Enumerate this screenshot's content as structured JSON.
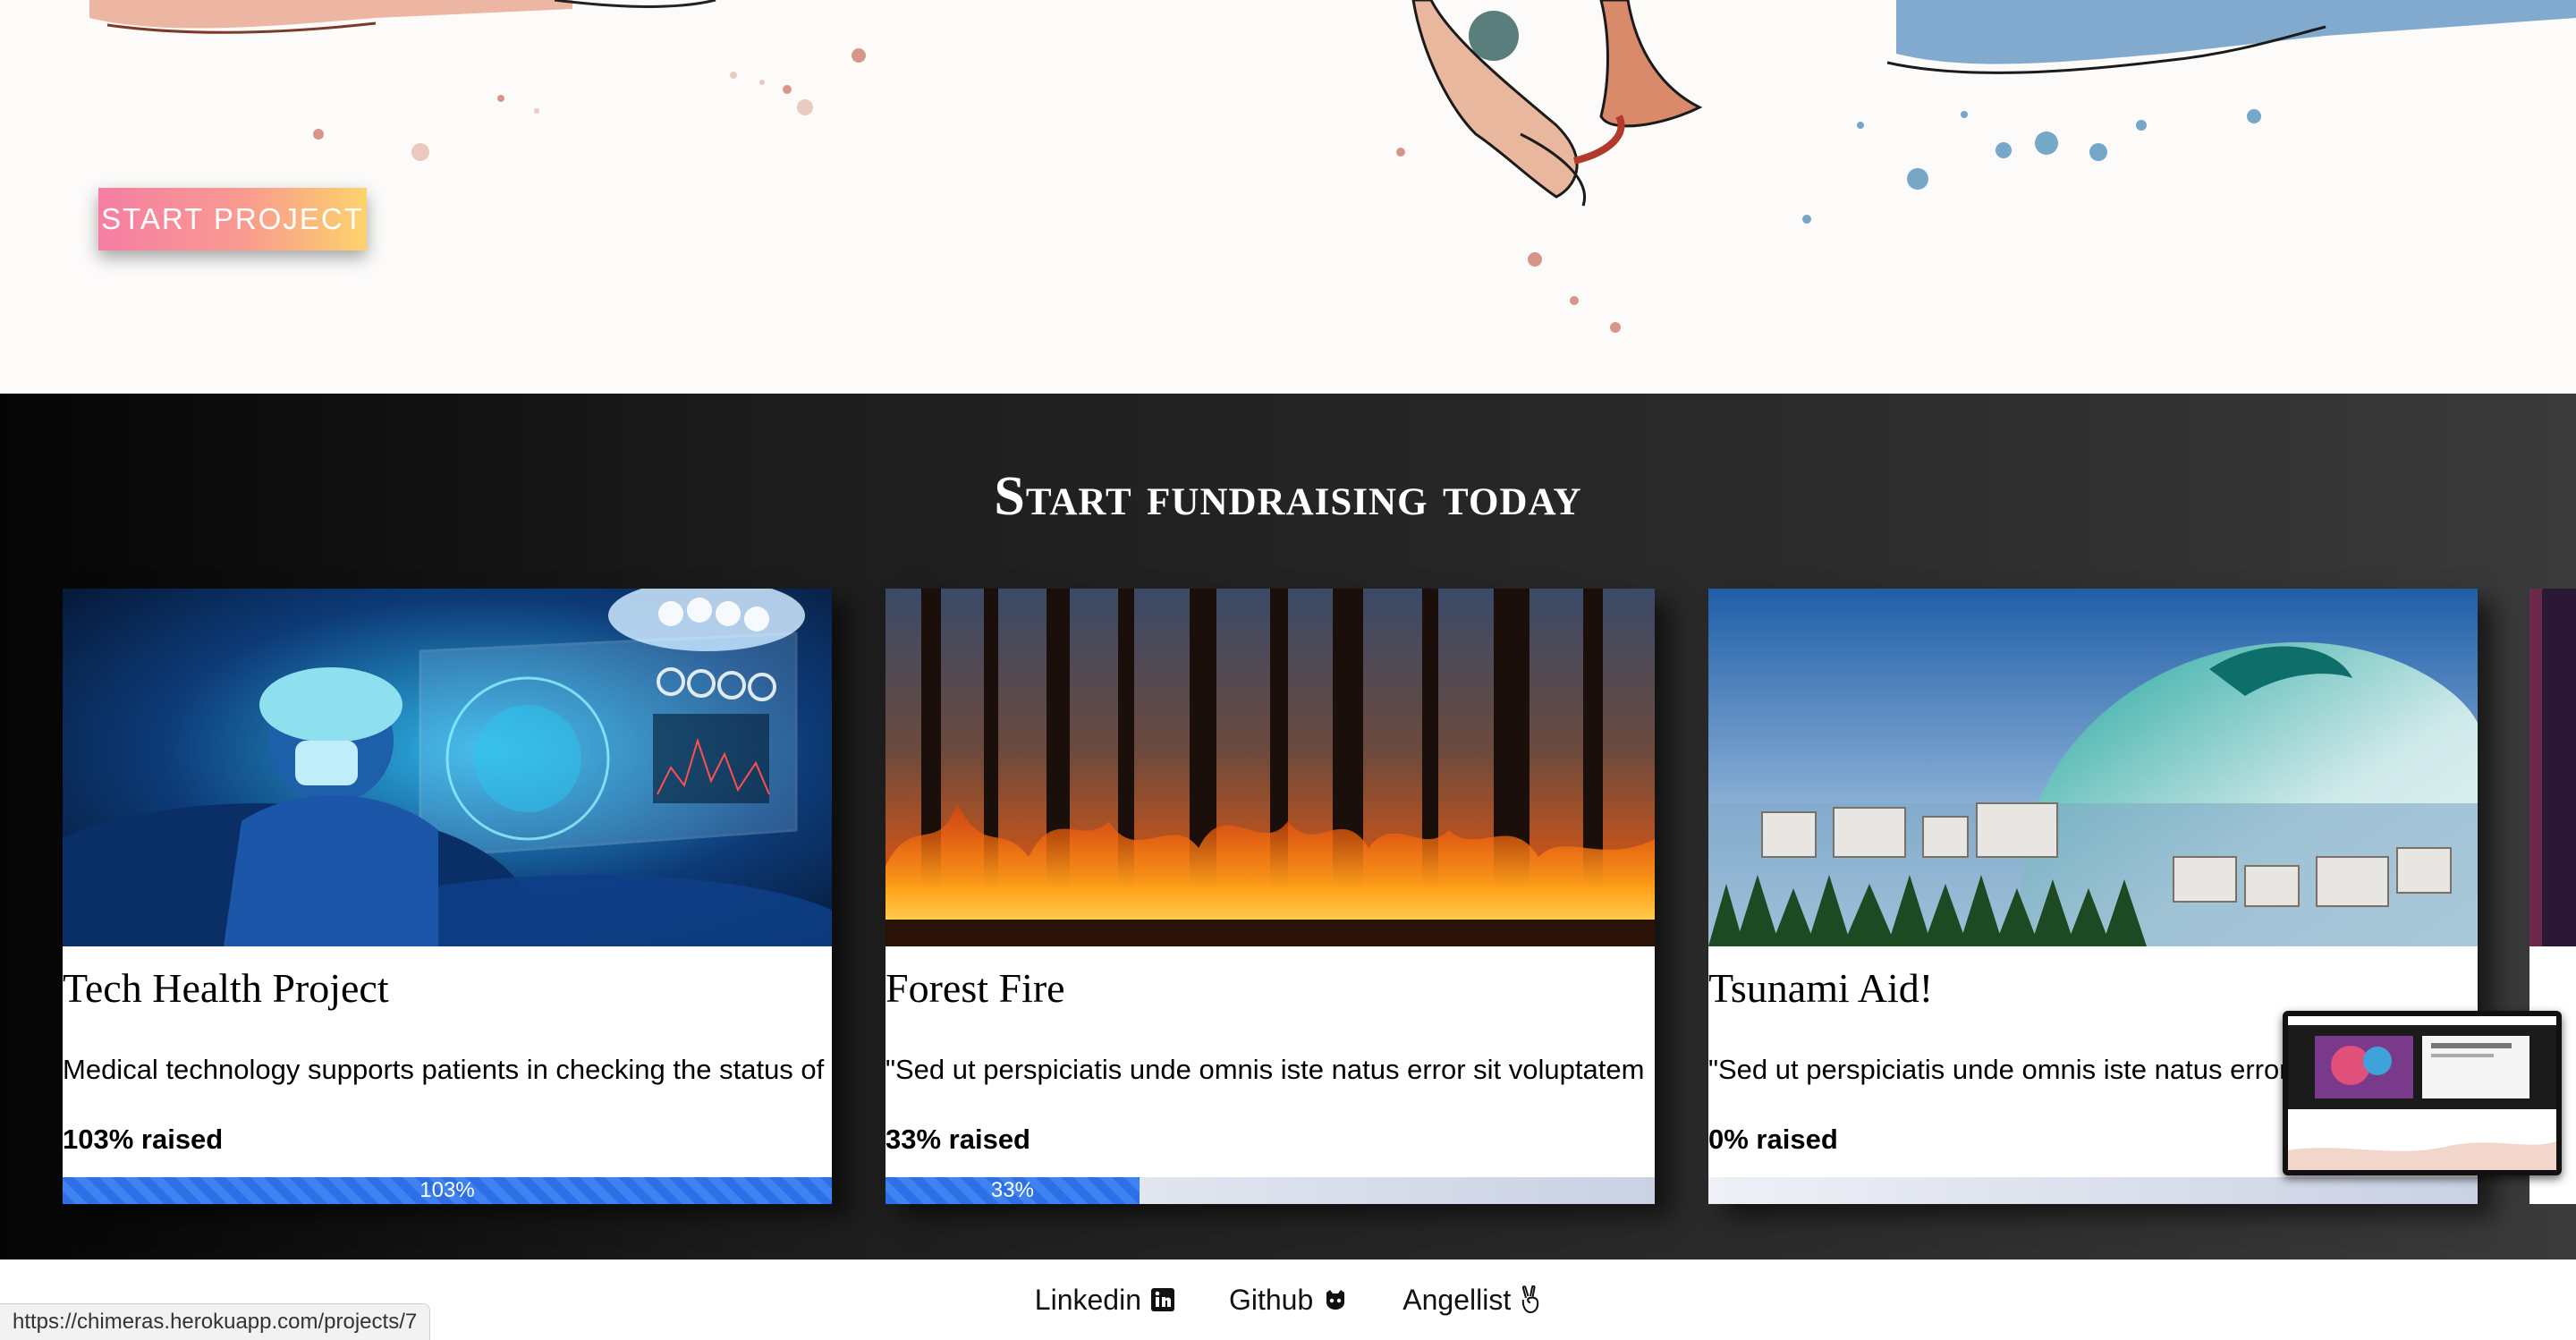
{
  "hero": {
    "start_button_label": "START PROJECT"
  },
  "fundraising": {
    "title": "Start fundraising today",
    "projects": [
      {
        "title": "Tech Health Project",
        "description": "Medical technology supports patients in checking the status of",
        "raised_label": "103% raised",
        "progress_percent": 103,
        "progress_label": "103%"
      },
      {
        "title": "Forest Fire",
        "description": "\"Sed ut perspiciatis unde omnis iste natus error sit voluptatem",
        "raised_label": "33% raised",
        "progress_percent": 33,
        "progress_label": "33%"
      },
      {
        "title": "Tsunami Aid!",
        "description": "\"Sed ut perspiciatis unde omnis iste natus error sit voluptatem",
        "raised_label": "0% raised",
        "progress_percent": 0,
        "progress_label": ""
      }
    ]
  },
  "footer": {
    "links": [
      {
        "label": "Linkedin",
        "icon": "linkedin-icon"
      },
      {
        "label": "Github",
        "icon": "github-icon"
      },
      {
        "label": "Angellist",
        "icon": "angellist-icon"
      }
    ]
  },
  "status_bar": {
    "url": "https://chimeras.herokuapp.com/projects/7"
  },
  "colors": {
    "progress_fill": "#2d6fe6",
    "button_gradient_start": "#f67ea4",
    "button_gradient_end": "#fcd36c"
  }
}
